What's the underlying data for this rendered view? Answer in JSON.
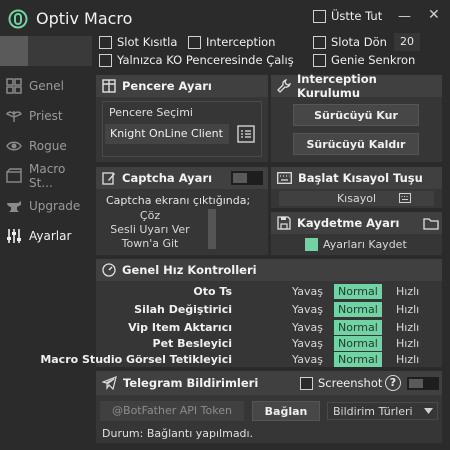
{
  "window": {
    "title": "Optiv Macro",
    "always_on_top_label": "Üstte Tut",
    "minimize_label": "—",
    "close_label": "✕"
  },
  "options": {
    "slot_limit": "Slot Kısıtla",
    "interception": "Interception",
    "slot_return": "Slota Dön",
    "slot_return_value": "20",
    "only_ko": "Yalnızca KO Penceresinde Çalış",
    "genie_sync": "Genie Senkron"
  },
  "sidebar": {
    "items": [
      {
        "label": "Genel",
        "icon": "grid-icon"
      },
      {
        "label": "Priest",
        "icon": "wings-icon"
      },
      {
        "label": "Rogue",
        "icon": "eye-icon"
      },
      {
        "label": "Macro St...",
        "icon": "film-icon"
      },
      {
        "label": "Upgrade",
        "icon": "anvil-icon"
      },
      {
        "label": "Ayarlar",
        "icon": "sliders-icon"
      }
    ],
    "active_index": 5
  },
  "window_panel": {
    "title": "Pencere Ayarı",
    "group_label": "Pencere Seçimi",
    "selected_window": "Knight OnLine Client"
  },
  "interception_panel": {
    "title": "Interception Kurulumu",
    "install_button": "Sürücüyü Kur",
    "remove_button": "Sürücüyü Kaldır"
  },
  "captcha_panel": {
    "title": "Captcha Ayarı",
    "label": "Captcha ekranı çıktığında;",
    "options": [
      "Çöz",
      "Sesli Uyarı Ver",
      "Town'a Git"
    ],
    "toggle_on": false
  },
  "hotkey_panel": {
    "title": "Başlat Kısayol Tuşu",
    "value": "Kısayol"
  },
  "save_panel": {
    "title": "Kaydetme Ayarı",
    "save_checkbox": "Ayarları Kaydet",
    "save_checked": true
  },
  "speed_panel": {
    "title": "Genel Hız Kontrolleri",
    "slow_label": "Yavaş",
    "fast_label": "Hızlı",
    "rows": [
      {
        "label": "Oto Ts",
        "value": "Normal"
      },
      {
        "label": "Silah Değiştirici",
        "value": "Normal"
      },
      {
        "label": "Vip Item Aktarıcı",
        "value": "Normal"
      },
      {
        "label": "Pet Besleyici",
        "value": "Normal"
      },
      {
        "label": "Macro Studio Görsel Tetikleyici",
        "value": "Normal"
      }
    ]
  },
  "telegram_panel": {
    "title": "Telegram Bildirimleri",
    "screenshot_label": "Screenshot",
    "help_label": "?",
    "token_placeholder": "@BotFather API Token",
    "connect_button": "Bağlan",
    "notify_select": "Bildirim Türleri",
    "status": "Durum: Bağlantı yapılmadı."
  },
  "colors": {
    "accent": "#6fd3a3",
    "background": "#2b2b2b",
    "panel": "#363636",
    "panel_header": "#404040"
  }
}
